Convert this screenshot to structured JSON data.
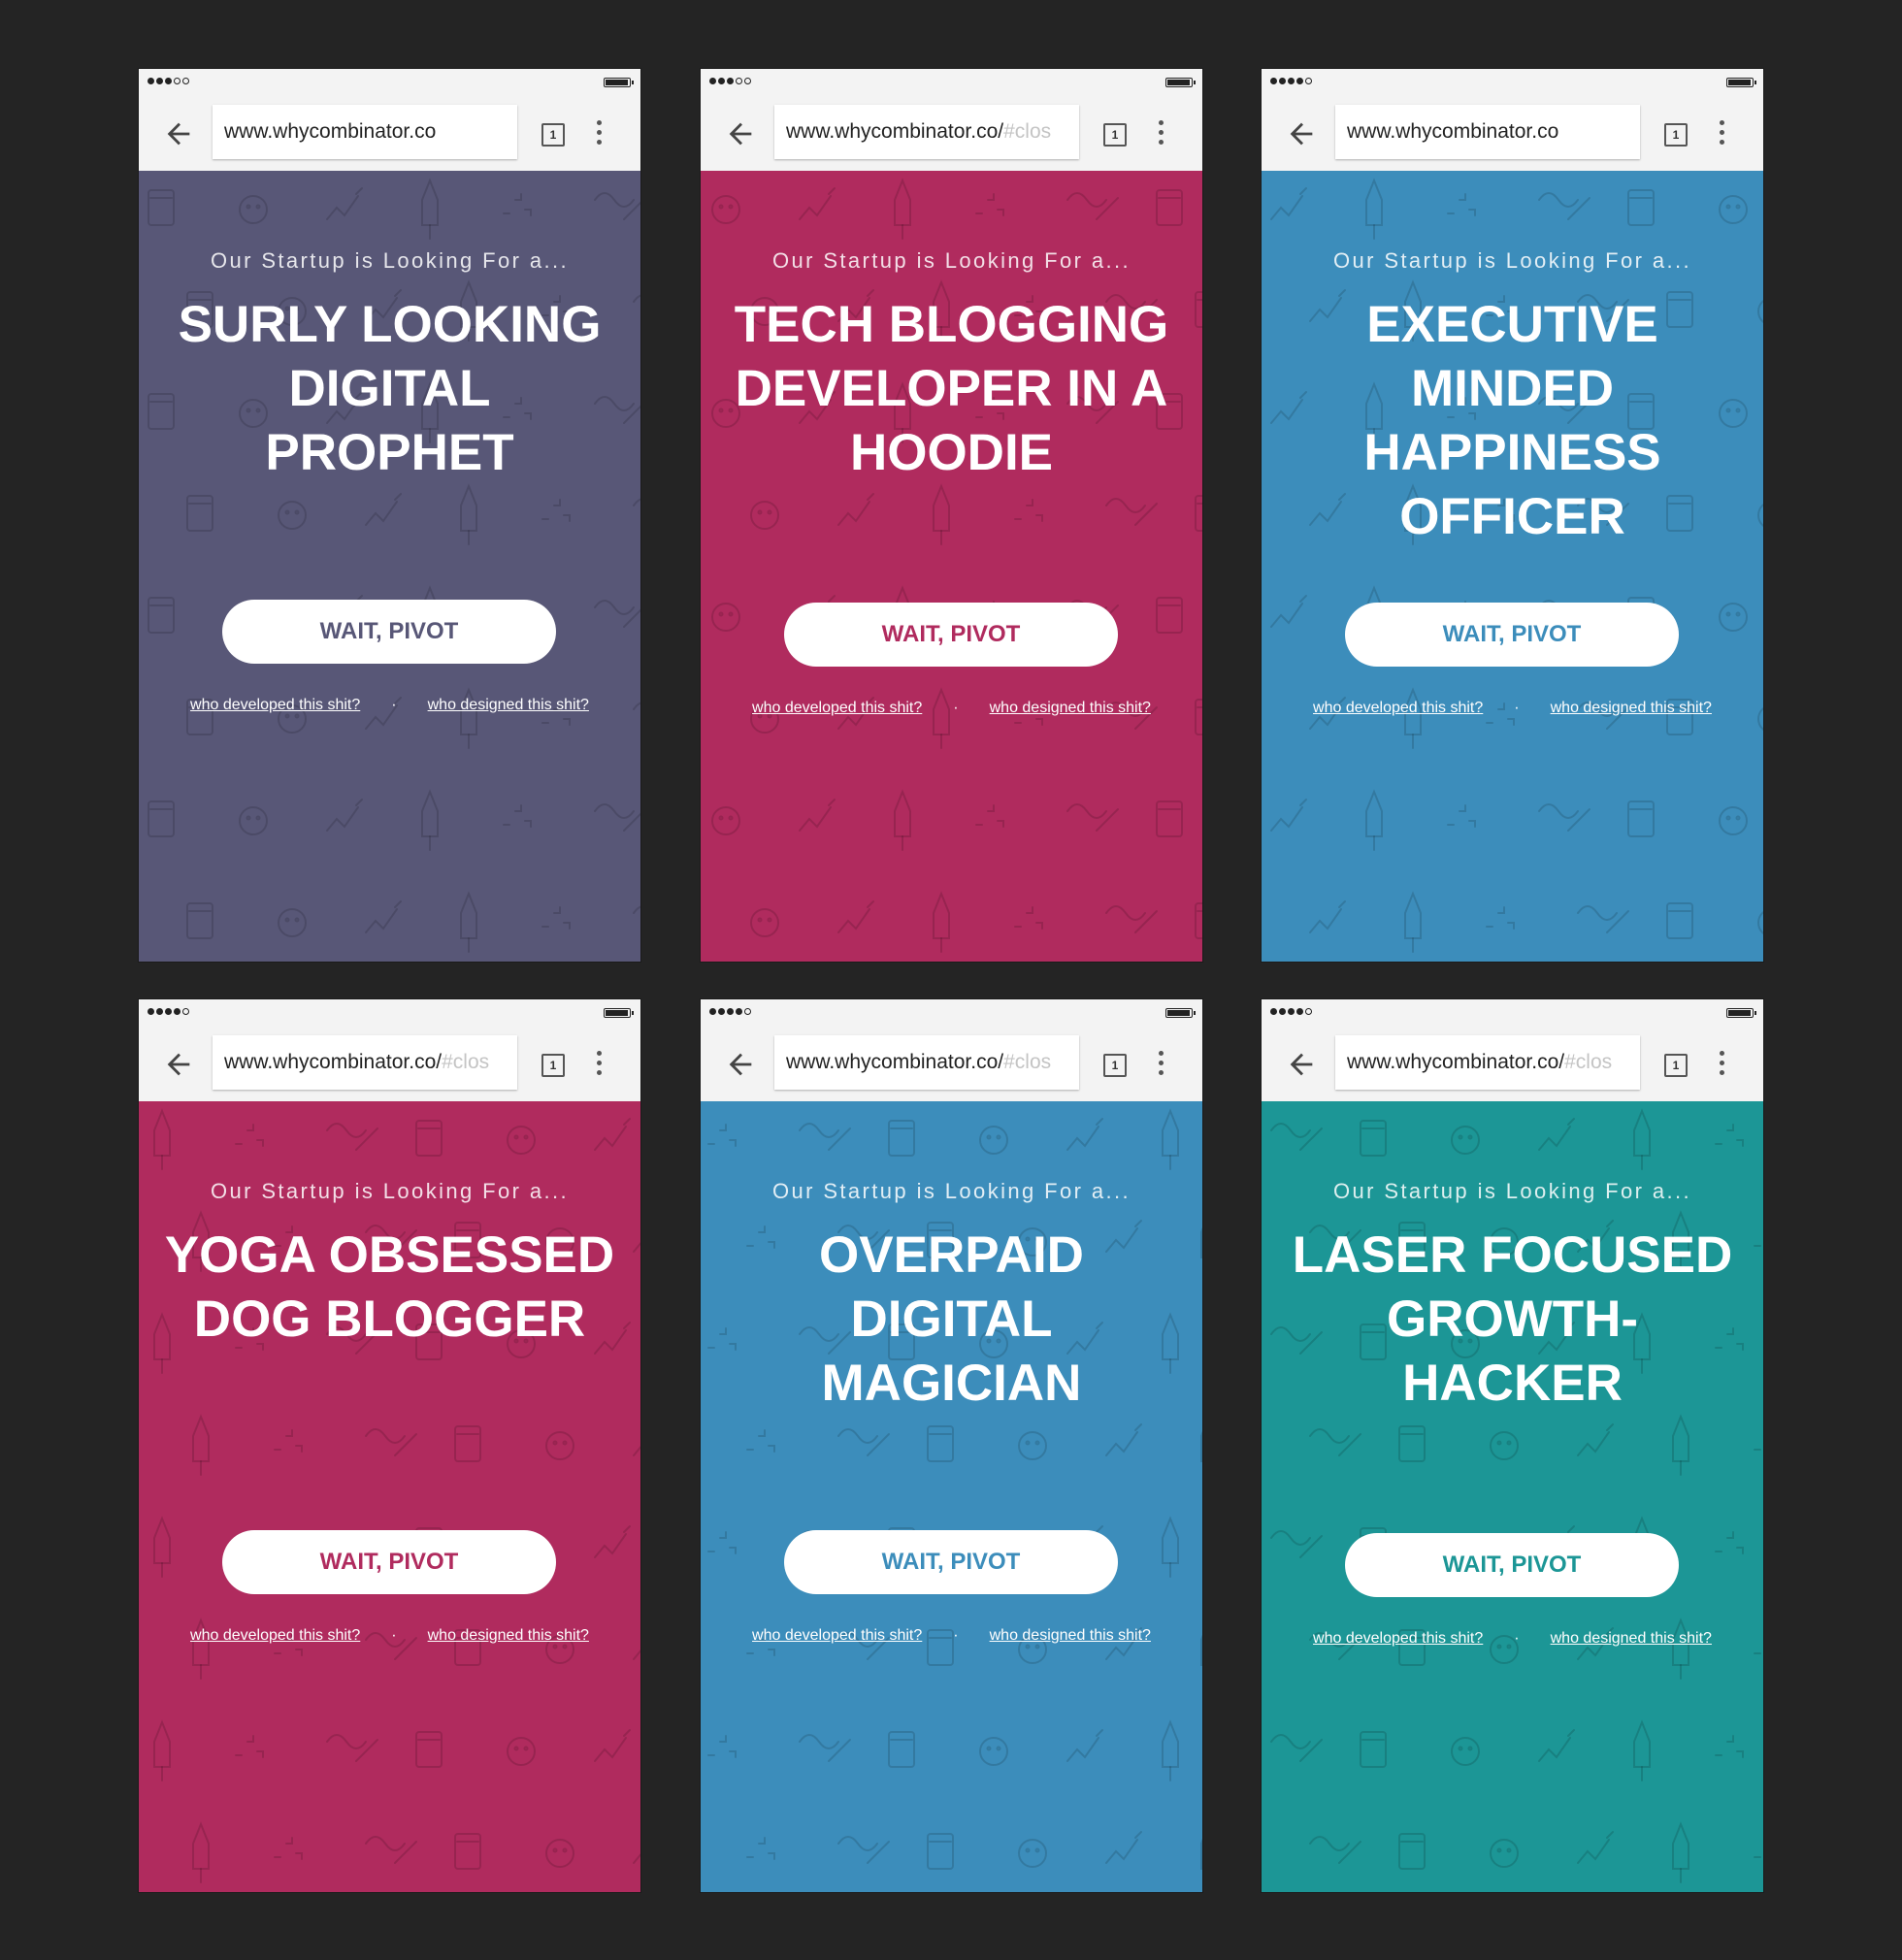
{
  "common": {
    "tagline": "Our Startup is Looking For a...",
    "button_label": "WAIT, PIVOT",
    "link_developed": "who developed this shit?",
    "link_designed": "who designed this shit?",
    "link_separator": "·",
    "tabs_count": "1"
  },
  "phones": [
    {
      "color": "#585777",
      "url": "www.whycombinator.co",
      "url_fragment": "",
      "role": "SURLY LOOKING DIGITAL PROPHET",
      "signal": [
        1,
        1,
        1,
        0,
        0
      ]
    },
    {
      "color": "#b02b5e",
      "url": "www.whycombinator.co/",
      "url_fragment": "#clos",
      "role": "TECH BLOGGING DEVELOPER IN A HOODIE",
      "signal": [
        1,
        1,
        1,
        0,
        0
      ]
    },
    {
      "color": "#3c8dbb",
      "url": "www.whycombinator.co",
      "url_fragment": "",
      "role": "EXECUTIVE MINDED HAPPINESS OFFICER",
      "signal": [
        1,
        1,
        1,
        1,
        0
      ]
    },
    {
      "color": "#b02b5e",
      "url": "www.whycombinator.co/",
      "url_fragment": "#clos",
      "role": "YOGA OBSESSED DOG BLOGGER",
      "signal": [
        1,
        1,
        1,
        1,
        0
      ]
    },
    {
      "color": "#3c8dbb",
      "url": "www.whycombinator.co/",
      "url_fragment": "#clos",
      "role": "OVERPAID DIGITAL MAGICIAN",
      "signal": [
        1,
        1,
        1,
        1,
        0
      ]
    },
    {
      "color": "#1c9696",
      "url": "www.whycombinator.co/",
      "url_fragment": "#clos",
      "role": "LASER FOCUSED GROWTH-HACKER",
      "signal": [
        1,
        1,
        1,
        1,
        0
      ]
    }
  ]
}
